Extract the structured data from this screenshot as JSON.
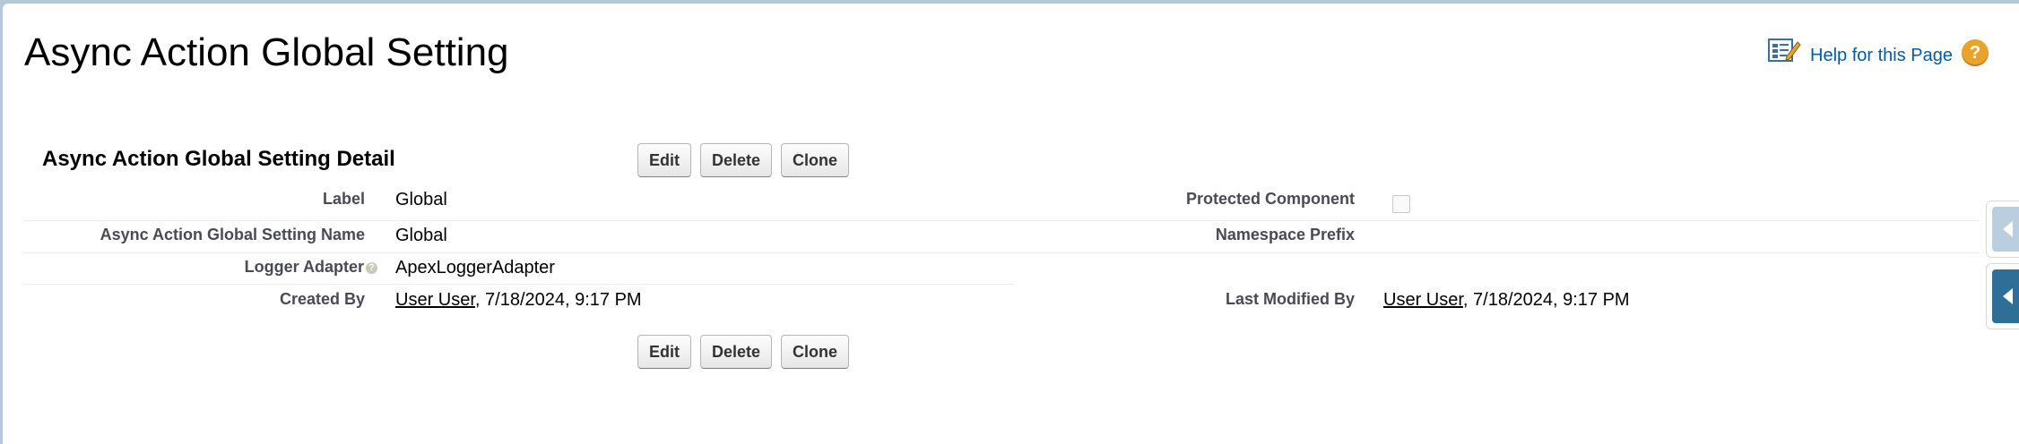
{
  "header": {
    "title": "Async Action Global Setting",
    "help_link": "Help for this Page",
    "help_icon": "question-mark",
    "doc_icon": "help-document-pencil"
  },
  "detail": {
    "title": "Async Action Global Setting Detail",
    "buttons": {
      "edit": "Edit",
      "delete": "Delete",
      "clone": "Clone"
    }
  },
  "fields": {
    "label": {
      "label": "Label",
      "value": "Global"
    },
    "name": {
      "label": "Async Action Global Setting Name",
      "value": "Global"
    },
    "logger": {
      "label": "Logger Adapter",
      "value": "ApexLoggerAdapter",
      "info_icon": "?"
    },
    "created": {
      "label": "Created By",
      "user": "User User",
      "date": ", 7/18/2024, 9:17 PM"
    },
    "protected": {
      "label": "Protected Component",
      "checked": false
    },
    "namespace": {
      "label": "Namespace Prefix",
      "value": ""
    },
    "modified": {
      "label": "Last Modified By",
      "user": "User User",
      "date": ", 7/18/2024, 9:17 PM"
    }
  },
  "colors": {
    "link": "#015ba7",
    "background": "#b6c7da",
    "side_tab_active": "#2e6e97",
    "side_tab_inactive": "#b9cfe0"
  }
}
